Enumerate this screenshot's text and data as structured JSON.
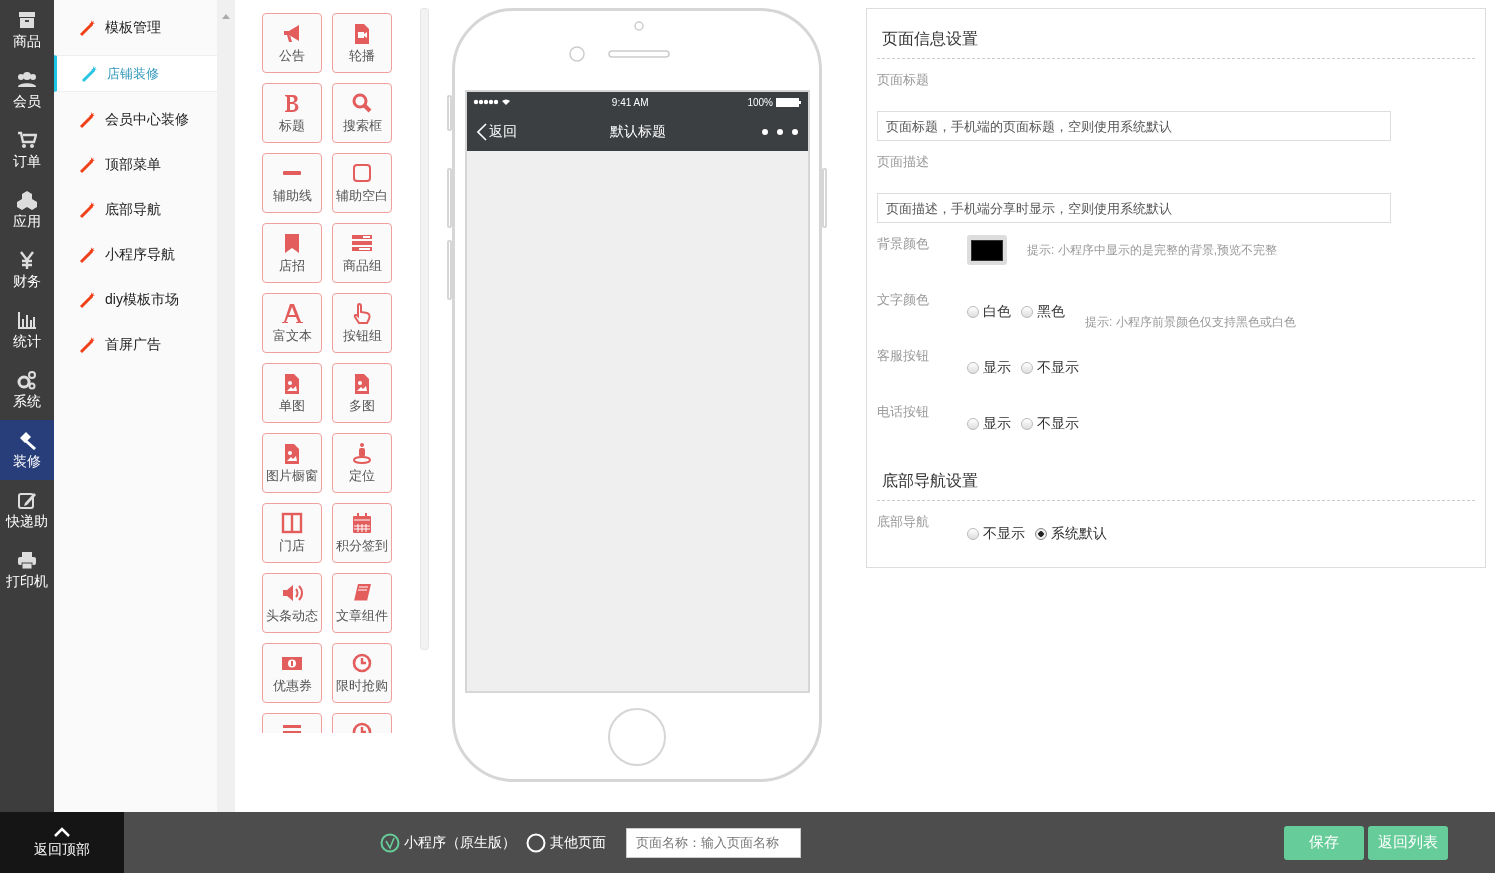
{
  "nav": [
    {
      "label": "商品",
      "selected": false
    },
    {
      "label": "会员",
      "selected": false
    },
    {
      "label": "订单",
      "selected": false
    },
    {
      "label": "应用",
      "selected": false
    },
    {
      "label": "财务",
      "selected": false
    },
    {
      "label": "统计",
      "selected": false
    },
    {
      "label": "系统",
      "selected": false
    },
    {
      "label": "装修",
      "selected": true
    },
    {
      "label": "快递助",
      "selected": false
    },
    {
      "label": "打印机",
      "selected": false
    }
  ],
  "submenu": [
    {
      "label": "模板管理",
      "selected": false
    },
    {
      "label": "店铺装修",
      "selected": true
    },
    {
      "label": "会员中心装修",
      "selected": false
    },
    {
      "label": "顶部菜单",
      "selected": false
    },
    {
      "label": "底部导航",
      "selected": false
    },
    {
      "label": "小程序导航",
      "selected": false
    },
    {
      "label": "diy模板市场",
      "selected": false
    },
    {
      "label": "首屏广告",
      "selected": false
    }
  ],
  "components": [
    {
      "label": "公告"
    },
    {
      "label": "轮播"
    },
    {
      "label": "标题"
    },
    {
      "label": "搜索框"
    },
    {
      "label": "辅助线"
    },
    {
      "label": "辅助空白"
    },
    {
      "label": "店招"
    },
    {
      "label": "商品组"
    },
    {
      "label": "富文本"
    },
    {
      "label": "按钮组"
    },
    {
      "label": "单图"
    },
    {
      "label": "多图"
    },
    {
      "label": "图片橱窗"
    },
    {
      "label": "定位"
    },
    {
      "label": "门店"
    },
    {
      "label": "积分签到"
    },
    {
      "label": "头条动态"
    },
    {
      "label": "文章组件"
    },
    {
      "label": "优惠券"
    },
    {
      "label": "限时抢购"
    },
    {
      "kind": "cut"
    },
    {
      "kind": "cut"
    }
  ],
  "phone": {
    "time": "9:41 AM",
    "battery": "100%",
    "back": "返回",
    "title": "默认标题"
  },
  "page_info": {
    "title": "页面信息设置",
    "fields": [
      {
        "kind": "input",
        "label": "页面标题",
        "placeholder": "页面标题，手机端的页面标题，空则使用系统默认"
      },
      {
        "kind": "input",
        "label": "页面描述",
        "placeholder": "页面描述，手机端分享时显示，空则使用系统默认"
      },
      {
        "kind": "color",
        "label": "背景颜色",
        "color": "#000000",
        "hint": "提示: 小程序中显示的是完整的背景,预览不完整"
      },
      {
        "kind": "radio",
        "label": "文字颜色",
        "options": [
          {
            "label": "白色",
            "selected": false
          },
          {
            "label": "黑色",
            "selected": false
          }
        ],
        "hint": "提示: 小程序前景颜色仅支持黑色或白色"
      },
      {
        "kind": "radio",
        "label": "客服按钮",
        "options": [
          {
            "label": "显示",
            "selected": false
          },
          {
            "label": "不显示",
            "selected": false
          }
        ]
      },
      {
        "kind": "radio",
        "label": "电话按钮",
        "options": [
          {
            "label": "显示",
            "selected": false
          },
          {
            "label": "不显示",
            "selected": false
          }
        ]
      }
    ]
  },
  "bottom_nav": {
    "title": "底部导航设置",
    "fields": [
      {
        "kind": "radio",
        "label": "底部导航",
        "options": [
          {
            "label": "不显示",
            "selected": false
          },
          {
            "label": "系统默认",
            "selected": true
          }
        ]
      }
    ]
  },
  "footer": {
    "back_to_top": "返回顶部",
    "page_types": [
      {
        "label": "小程序（原生版）",
        "selected": true
      },
      {
        "label": "其他页面",
        "selected": false
      }
    ],
    "name_field": {
      "placeholder": "页面名称：输入页面名称"
    },
    "buttons": [
      "保存",
      "返回列表"
    ]
  }
}
